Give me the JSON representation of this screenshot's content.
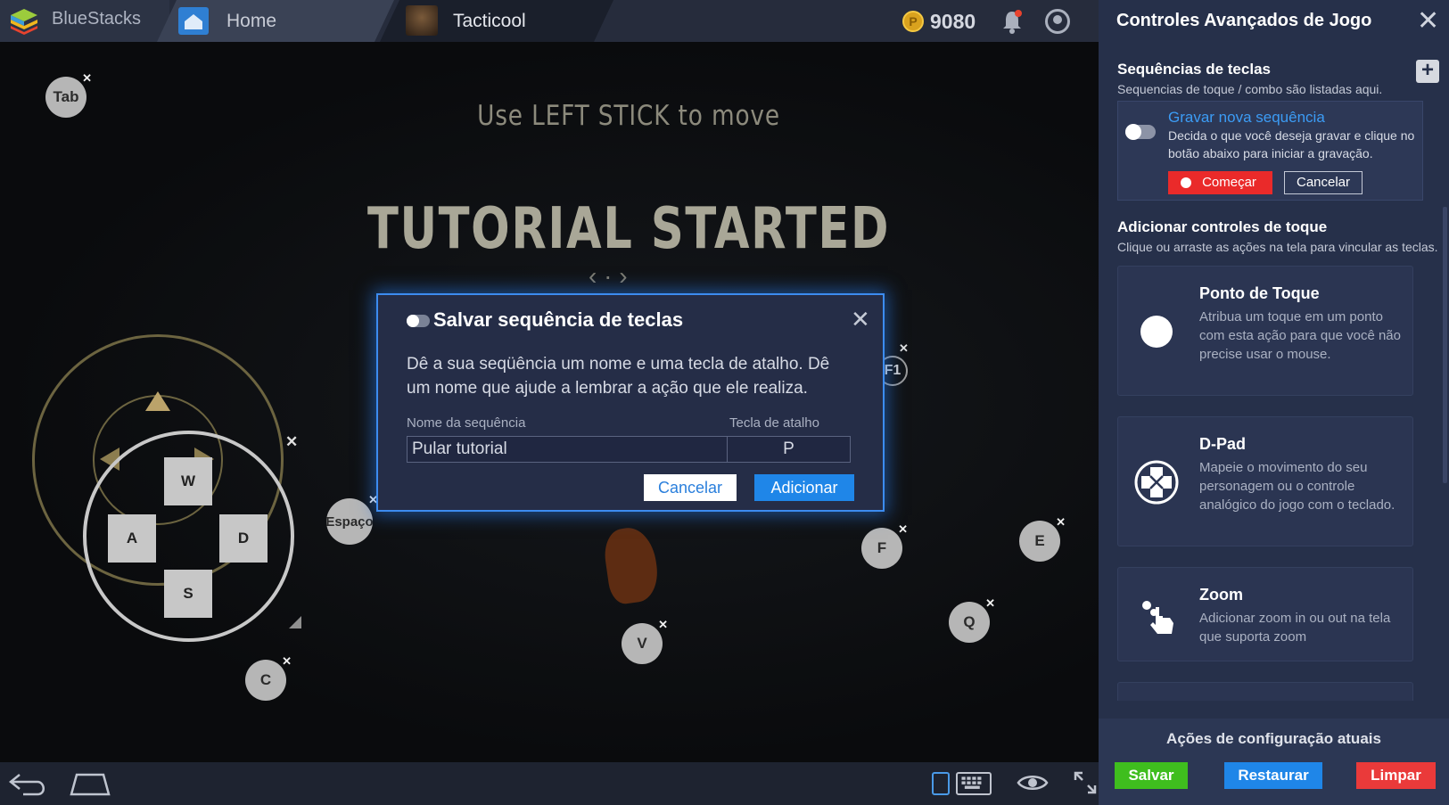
{
  "tabs": {
    "app_name": "BlueStacks",
    "home": "Home",
    "game": "Tacticool"
  },
  "header": {
    "coins": "9080",
    "coin_symbol": "P"
  },
  "game": {
    "hint": "Use LEFT STICK to move",
    "tutorial": "TUTORIAL STARTED",
    "nav_arrows": "‹ · ›",
    "keys": {
      "tab": "Tab",
      "space": "Espaço",
      "f": "F",
      "e": "E",
      "q": "Q",
      "v": "V",
      "c": "C",
      "f1": "F1"
    },
    "dpad": {
      "up": "W",
      "left": "A",
      "right": "D",
      "down": "S"
    },
    "close_glyph": "✕"
  },
  "dialog": {
    "title": "Salvar sequência de teclas",
    "close": "✕",
    "description": "Dê a sua seqüência um nome e uma tecla de atalho. Dê um nome que ajude a lembrar a ação que ele realiza.",
    "name_label": "Nome da sequência",
    "name_value": "Pular tutorial",
    "key_label": "Tecla de atalho",
    "key_value": "P",
    "cancel": "Cancelar",
    "add": "Adicionar"
  },
  "panel": {
    "title": "Controles Avançados de Jogo",
    "close": "✕",
    "sequences": {
      "title": "Sequências de teclas",
      "subtitle": "Sequencias de  toque / combo são listadas aqui.",
      "plus": "+",
      "record_title": "Gravar nova sequência",
      "record_desc": "Decida o que você deseja gravar e clique no botão abaixo para iniciar a gravação.",
      "start": "Começar",
      "cancel": "Cancelar"
    },
    "touch": {
      "title": "Adicionar controles de toque",
      "subtitle": "Clique ou arraste as ações na tela para vincular as teclas.",
      "items": [
        {
          "name": "Ponto de Toque",
          "desc": "Atribua um toque em um ponto com esta ação para que você não precise usar o mouse.",
          "icon": "touch-point-icon"
        },
        {
          "name": "D-Pad",
          "desc": "Mapeie o movimento do seu personagem ou o controle analógico do jogo com o teclado.",
          "icon": "dpad-icon"
        },
        {
          "name": "Zoom",
          "desc": "Adicionar zoom in ou out na tela que suporta zoom",
          "icon": "zoom-icon"
        }
      ]
    },
    "footer": {
      "title": "Ações de configuração atuais",
      "save": "Salvar",
      "restore": "Restaurar",
      "clear": "Limpar"
    }
  },
  "colors": {
    "accent_blue": "#1f86e8",
    "record_red": "#ea2a2a",
    "save_green": "#3fbe1e",
    "restore_blue": "#1f86e8",
    "clear_red": "#ea3a3a"
  }
}
